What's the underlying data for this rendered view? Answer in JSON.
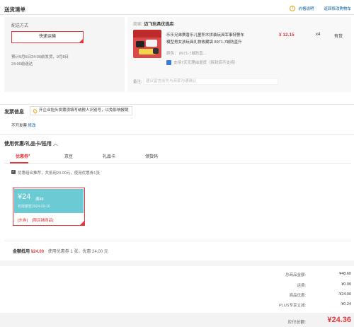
{
  "header": {
    "title": "送货清单",
    "price_note": "价格说明",
    "back_cart": "返回修改购物车"
  },
  "shipping": {
    "method_label": "配送方式",
    "method_value": "快递运输",
    "estimate_line1": "预计9月6日24:00前发货，9月8日",
    "estimate_line2": "24:00前送达"
  },
  "shop": {
    "label": "商家:",
    "name": "迈飞玩具优选店"
  },
  "product": {
    "title_line1": "乐乐兄弟赛香乐儿童积木拼装玩具军事特警车",
    "title_line2": "模型男女孩玩具礼物收藏袋 8971-7城防直升",
    "price": "¥ 12.15",
    "qty": "x4",
    "stock": "有货",
    "color_label": "颜色：",
    "color_value": "8971-7城防直...",
    "return_policy": "支持7天无理由退货（拆封后不支持）"
  },
  "remark": {
    "label": "备注:",
    "placeholder": "建议留言前先与商家沟通确认"
  },
  "invoice": {
    "title": "发票信息",
    "tip": "开企业抬头发票须填写纳税人识别号，以免影响报销",
    "status": "不开发票",
    "edit": "修改"
  },
  "coupons": {
    "title": "使用优惠/礼品卡/抵用",
    "tabs": [
      "优惠券",
      "京豆",
      "礼品卡",
      "领货码"
    ],
    "tab_badge": "●",
    "combo_note": "优惠组合推荐，共抵用24.00元，使用优惠券1张",
    "card": {
      "amount": "¥24",
      "condition": "满48",
      "validity": "有效期至2024-09-10",
      "tag": "[东券]",
      "scope": "[限店铺商品]"
    },
    "summary_label": "金额抵用",
    "summary_amount": "¥24.00",
    "summary_note": "使用优惠券 1 张，优惠 24.00 元"
  },
  "totals": {
    "rows": [
      {
        "label": "总商品金额:",
        "value": "¥48.60"
      },
      {
        "label": "运费:",
        "value": "¥0.00"
      },
      {
        "label": "商品优惠:",
        "value": "-¥24.00"
      },
      {
        "label": "PLUS专享立减:",
        "value": "-¥0.24"
      }
    ],
    "payable_label": "应付总额:",
    "payable_value": "¥24.36"
  },
  "colors": {
    "accent": "#e4393c",
    "coupon_bg": "#6bcad3",
    "link": "#005aa0"
  }
}
